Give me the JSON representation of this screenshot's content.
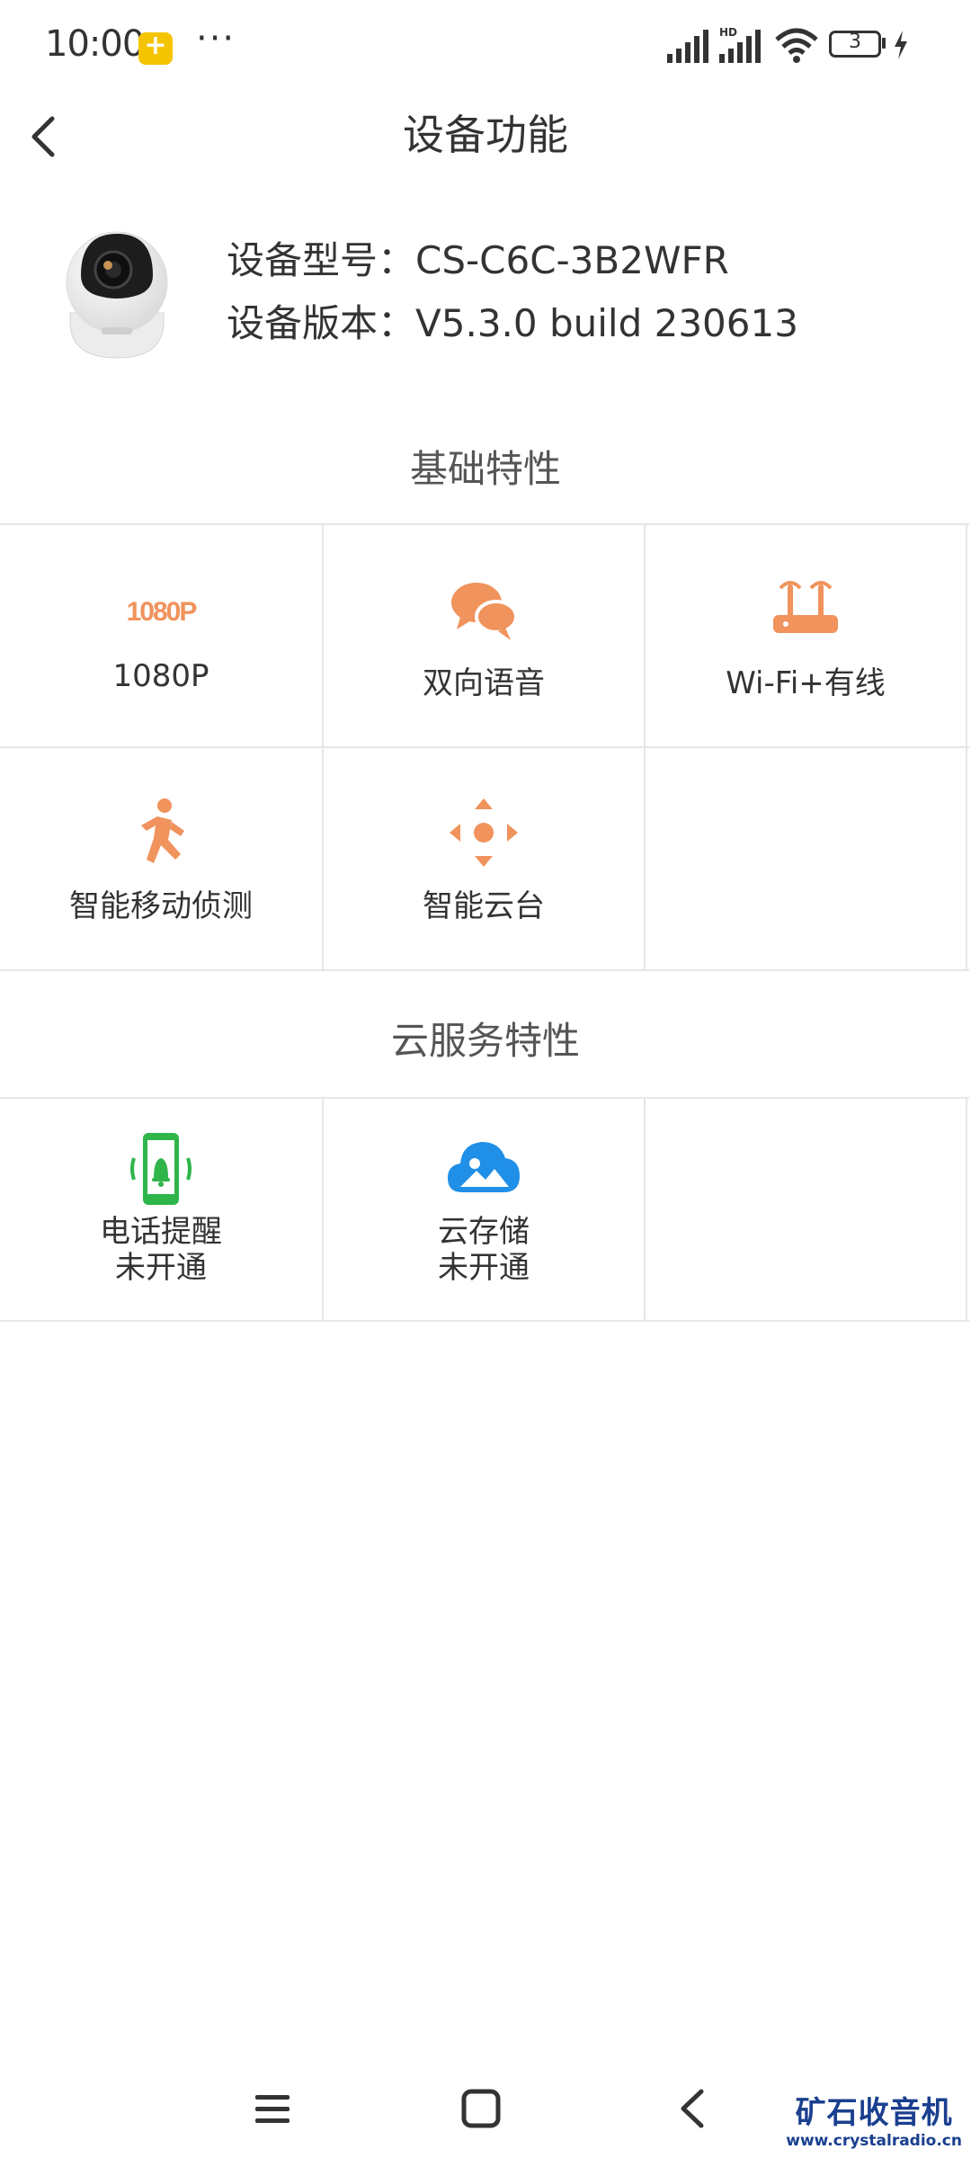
{
  "status_bar": {
    "time": "10:00",
    "dots": "···",
    "battery": "3",
    "network_label": "HD"
  },
  "header": {
    "title": "设备功能",
    "back_icon": "chevron-left-icon"
  },
  "device": {
    "model_label": "设备型号：",
    "model_value": "CS-C6C-3B2WFR",
    "version_label": "设备版本：",
    "version_value": "V5.3.0 build 230613"
  },
  "sections": {
    "basic_title": "基础特性",
    "cloud_title": "云服务特性"
  },
  "basic_features": [
    {
      "label": "1080P",
      "icon": "1080p-icon",
      "icon_text": "1080P"
    },
    {
      "label": "双向语音",
      "icon": "chat-bubbles-icon"
    },
    {
      "label": "Wi-Fi+有线",
      "icon": "router-icon"
    },
    {
      "label": "智能移动侦测",
      "icon": "running-person-icon"
    },
    {
      "label": "智能云台",
      "icon": "ptz-direction-icon"
    }
  ],
  "cloud_features": [
    {
      "label": "电话提醒",
      "status": "未开通",
      "icon": "phone-bell-icon"
    },
    {
      "label": "云存储",
      "status": "未开通",
      "icon": "cloud-image-icon"
    }
  ],
  "colors": {
    "accent_orange": "#f0935c",
    "green": "#2fb54a",
    "blue": "#1f8fe8",
    "divider": "#e6e6e6"
  },
  "watermark": {
    "title": "矿石收音机",
    "url": "www.crystalradio.cn"
  }
}
